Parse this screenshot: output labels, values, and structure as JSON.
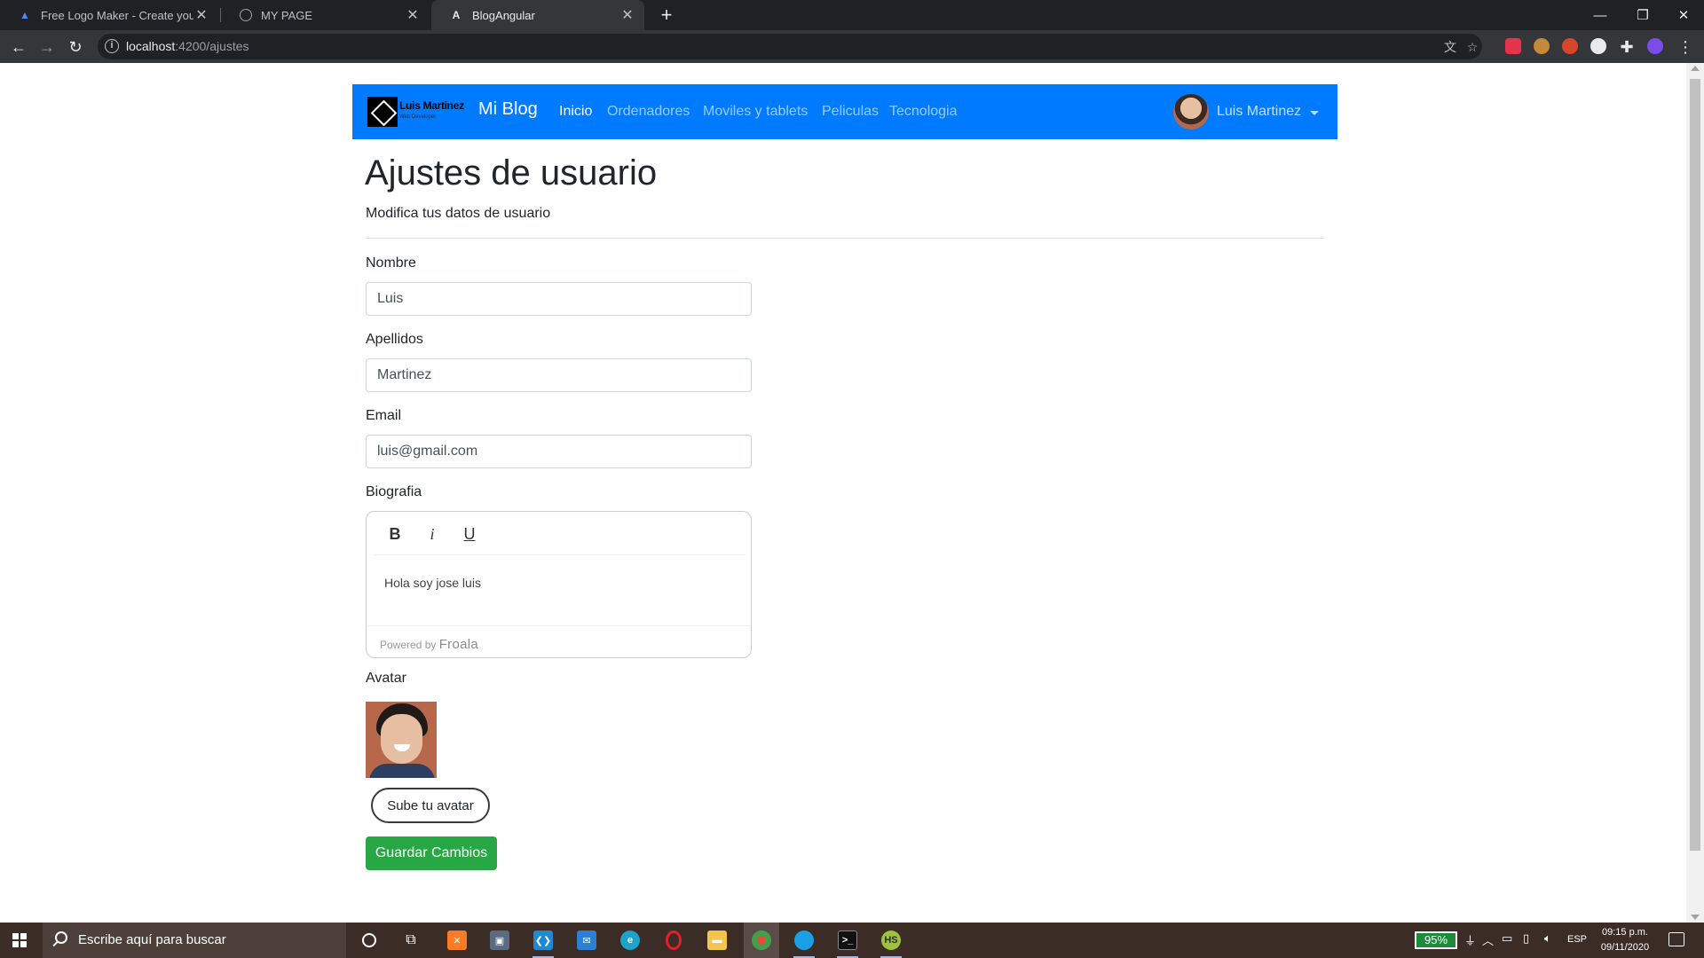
{
  "browser": {
    "tabs": [
      {
        "title": "Free Logo Maker - Create your o",
        "active": false
      },
      {
        "title": "MY PAGE",
        "active": false
      },
      {
        "title": "BlogAngular",
        "active": true
      }
    ],
    "url_host": "localhost",
    "url_path": ":4200/ajustes"
  },
  "navbar": {
    "logo_name": "Luis Martinez",
    "logo_sub": "Web Developer",
    "brand": "Mi Blog",
    "links": [
      "Inicio",
      "Ordenadores",
      "Moviles y tablets",
      "Peliculas",
      "Tecnologia"
    ],
    "active_link": "Inicio",
    "user_name": "Luis Martinez"
  },
  "page": {
    "title": "Ajustes de usuario",
    "subtitle": "Modifica tus datos de usuario"
  },
  "form": {
    "nombre_label": "Nombre",
    "nombre_value": "Luis",
    "apellidos_label": "Apellidos",
    "apellidos_value": "Martinez",
    "email_label": "Email",
    "email_value": "luis@gmail.com",
    "bio_label": "Biografia",
    "bio_toolbar": [
      "B",
      "i",
      "U"
    ],
    "bio_content": "Hola soy jose luis",
    "bio_powered": "Powered by",
    "bio_powered_brand": "Froala",
    "avatar_label": "Avatar",
    "upload_button": "Sube tu avatar",
    "save_button": "Guardar Cambios"
  },
  "taskbar": {
    "search_placeholder": "Escribe aquí para buscar",
    "battery": "95%",
    "language": "ESP",
    "time": "09:15 p.m.",
    "date": "09/11/2020"
  },
  "colors": {
    "navbar": "#007bff",
    "save_button": "#28a745",
    "taskbar": "#3b2c26"
  }
}
